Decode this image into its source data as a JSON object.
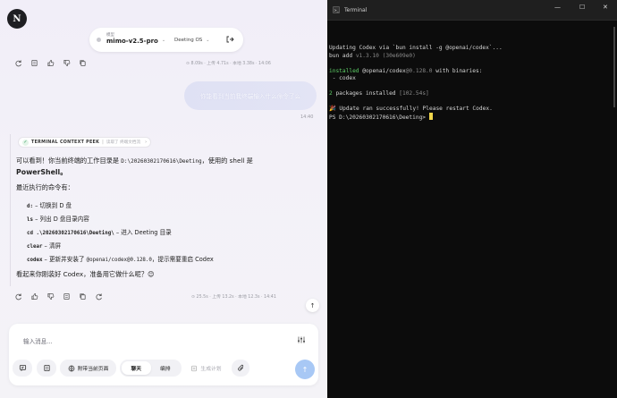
{
  "app": {
    "logo_letter": "N"
  },
  "header": {
    "model_label": "模型",
    "model_name": "mimo-v2.5-pro",
    "workspace": "Deeting OS"
  },
  "top_stats": "⊙ 8.09s · 上传 4.71s · 本地 3.38s · 14:06",
  "user_message": {
    "text": "你能看到当前我终端输入什么命令了么",
    "time": "14:40"
  },
  "peek": {
    "title": "TERMINAL CONTEXT PEEK",
    "subtitle": "读取了 终端文档流"
  },
  "answer": {
    "line1_a": "可以看到！你当前终端的工作目录是 ",
    "line1_path": "D:\\20260302170616\\Deeting",
    "line1_b": "，使用的 shell 是",
    "line2": "PowerShell。",
    "line3": "最近执行的命令有：",
    "cmd1_code": "d:",
    "cmd1_desc": " – 切换到 D 盘",
    "cmd2_code": "ls",
    "cmd2_desc": " – 列出 D 盘目录内容",
    "cmd3_code": "cd .\\20260302170616\\Deeting\\",
    "cmd3_desc": " – 进入 Deeting 目录",
    "cmd4_code": "clear",
    "cmd4_desc": " – 清屏",
    "cmd5_code": "codex",
    "cmd5_desc_a": " – 更新并安装了 ",
    "cmd5_pkg": "@openai/codex@0.128.0",
    "cmd5_desc_b": "，提示需要重启 Codex",
    "closing": "看起来你刚装好 Codex，准备用它做什么呢？😊"
  },
  "bottom_stats": "⊙ 25.5s · 上传 13.2s · 本地 12.3s · 14:41",
  "composer": {
    "placeholder": "输入消息...",
    "attach_page": "附带当前页面",
    "mode_chat": "聊天",
    "mode_edit": "编排",
    "generate_plan": "生成计划"
  },
  "terminal": {
    "title": "Terminal",
    "line1": "Updating Codex via `bun install -g @openai/codex`...",
    "line2_a": "bun add ",
    "line2_b": "v1.3.10 (30e609e0)",
    "line3_a": "installed ",
    "line3_b": "@openai/codex",
    "line3_c": "@0.128.0",
    "line3_d": " with binaries:",
    "line4": " - codex",
    "line5_a": "2",
    "line5_b": " packages installed ",
    "line5_c": "[102.54s]",
    "line6": "🎉 Update ran successfully! Please restart Codex.",
    "line7": "PS D:\\20260302170616\\Deeting> "
  }
}
